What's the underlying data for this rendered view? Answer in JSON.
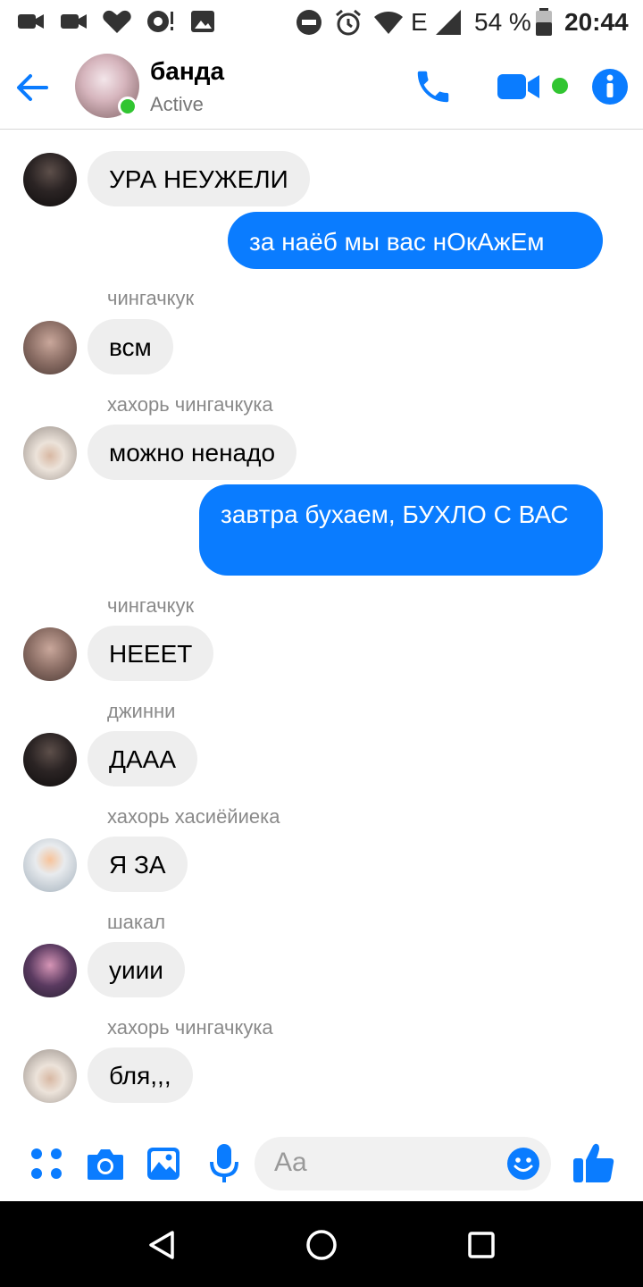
{
  "status_bar": {
    "battery": "54 %",
    "network": "E",
    "time": "20:44"
  },
  "header": {
    "title": "банда",
    "status": "Active"
  },
  "messages": [
    {
      "dir": "in",
      "sender": "",
      "text": "УРА НЕУЖЕЛИ"
    },
    {
      "dir": "out",
      "sender": "",
      "text": "за наёб мы вас нОкАжЕм"
    },
    {
      "dir": "in",
      "sender": "чингачкук",
      "text": "всм"
    },
    {
      "dir": "in",
      "sender": "хахорь чингачкука",
      "text": "можно ненадо"
    },
    {
      "dir": "out",
      "sender": "",
      "text": "завтра бухаем, БУХЛО С ВАС"
    },
    {
      "dir": "in",
      "sender": "чингачкук",
      "text": "НЕЕЕТ"
    },
    {
      "dir": "in",
      "sender": "джинни",
      "text": "ДААА"
    },
    {
      "dir": "in",
      "sender": "хахорь хасиёйиека",
      "text": "Я ЗА"
    },
    {
      "dir": "in",
      "sender": "шакал",
      "text": "уиии"
    },
    {
      "dir": "in",
      "sender": "хахорь чингачкука",
      "text": "бля,,,"
    }
  ],
  "composer": {
    "placeholder": "Aa"
  },
  "colors": {
    "accent": "#0a7cff",
    "online": "#31c531",
    "incoming_bubble": "#eeeeee"
  }
}
